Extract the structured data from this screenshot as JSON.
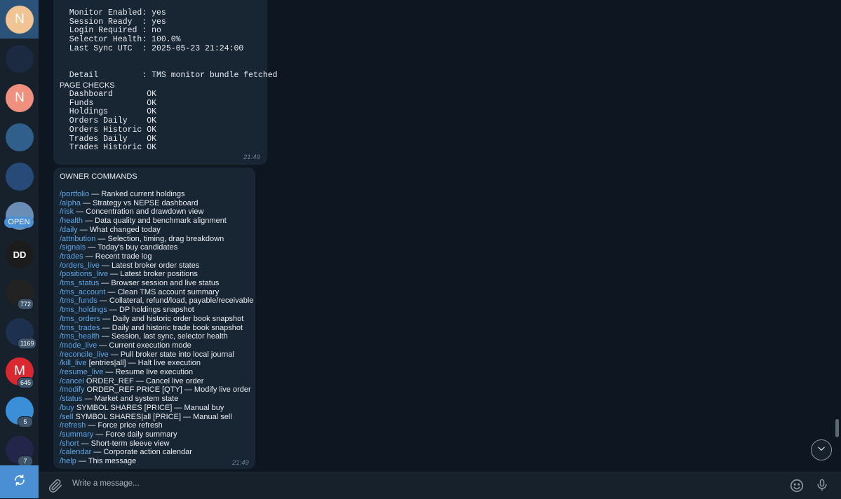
{
  "sidebar": {
    "chats": [
      {
        "initial": "N",
        "color": "#f0c493",
        "badge": ""
      },
      {
        "initial": "",
        "color": "#1b2a40",
        "badge": ""
      },
      {
        "initial": "N",
        "color": "#f0907e",
        "badge": ""
      },
      {
        "initial": "",
        "color": "#2f5f8a",
        "badge": ""
      },
      {
        "initial": "",
        "color": "#284a78",
        "badge": ""
      },
      {
        "initial": "",
        "color": "#6a8db5",
        "badge": "",
        "pill": "OPEN"
      },
      {
        "initial": "DD",
        "color": "#1c1c1c",
        "badge": ""
      },
      {
        "initial": "",
        "color": "#222222",
        "badge": "772"
      },
      {
        "initial": "",
        "color": "#1e3050",
        "badge": "1169"
      },
      {
        "initial": "M",
        "color": "#d9282f",
        "badge": "645"
      },
      {
        "initial": "",
        "color": "#3b8fd9",
        "badge": "5"
      },
      {
        "initial": "",
        "color": "#23264a",
        "badge": "7"
      }
    ],
    "refresh_icon": "refresh-icon"
  },
  "messages": {
    "status_block": {
      "lines": [
        "  Monitor Enabled: yes",
        "  Session Ready  : yes",
        "  Login Required : no",
        "  Selector Health: 100.0%",
        "  Last Sync UTC  : 2025-05-23 21:24:00",
        "",
        "",
        "  Detail         : TMS monitor bundle fetched"
      ],
      "page_checks_title": "PAGE CHECKS",
      "page_checks": [
        "  Dashboard       OK",
        "  Funds           OK",
        "  Holdings        OK",
        "  Orders Daily    OK",
        "  Orders Historic OK",
        "  Trades Daily    OK",
        "  Trades Historic OK"
      ],
      "time": "21:49"
    },
    "commands_block": {
      "title": "OWNER COMMANDS",
      "commands": [
        {
          "cmd": "/portfolio",
          "desc": " — Ranked current holdings"
        },
        {
          "cmd": "/alpha",
          "desc": " — Strategy vs NEPSE dashboard"
        },
        {
          "cmd": "/risk",
          "desc": " — Concentration and drawdown view"
        },
        {
          "cmd": "/health",
          "desc": " — Data quality and benchmark alignment"
        },
        {
          "cmd": "/daily",
          "desc": " — What changed today"
        },
        {
          "cmd": "/attribution",
          "desc": " — Selection, timing, drag breakdown"
        },
        {
          "cmd": "/signals",
          "desc": " — Today's buy candidates"
        },
        {
          "cmd": "/trades",
          "desc": " — Recent trade log"
        },
        {
          "cmd": "/orders_live",
          "desc": " — Latest broker order states"
        },
        {
          "cmd": "/positions_live",
          "desc": " — Latest broker positions"
        },
        {
          "cmd": "/tms_status",
          "desc": " — Browser session and live status"
        },
        {
          "cmd": "/tms_account",
          "desc": " — Clean TMS account summary"
        },
        {
          "cmd": "/tms_funds",
          "desc": " — Collateral, refund/load, payable/receivable"
        },
        {
          "cmd": "/tms_holdings",
          "desc": " — DP holdings snapshot"
        },
        {
          "cmd": "/tms_orders",
          "desc": " — Daily and historic order book snapshot"
        },
        {
          "cmd": "/tms_trades",
          "desc": " — Daily and historic trade book snapshot"
        },
        {
          "cmd": "/tms_health",
          "desc": " — Session, last sync, selector health"
        },
        {
          "cmd": "/mode_live",
          "desc": " — Current execution mode"
        },
        {
          "cmd": "/reconcile_live",
          "desc": " — Pull broker state into local journal"
        },
        {
          "cmd": "/kill_live",
          "desc": " [entries|all] — Halt live execution"
        },
        {
          "cmd": "/resume_live",
          "desc": " — Resume live execution"
        },
        {
          "cmd": "/cancel",
          "desc": " ORDER_REF — Cancel live order"
        },
        {
          "cmd": "/modify",
          "desc": " ORDER_REF PRICE [QTY] — Modify live order"
        },
        {
          "cmd": "/status",
          "desc": " — Market and system state"
        },
        {
          "cmd": "/buy",
          "desc": " SYMBOL SHARES [PRICE] — Manual buy"
        },
        {
          "cmd": "/sell",
          "desc": " SYMBOL SHARES|all [PRICE] — Manual sell"
        },
        {
          "cmd": "/refresh",
          "desc": " — Force price refresh"
        },
        {
          "cmd": "/summary",
          "desc": " — Force daily summary"
        },
        {
          "cmd": "/short",
          "desc": " — Short-term sleeve view"
        },
        {
          "cmd": "/calendar",
          "desc": " — Corporate action calendar"
        },
        {
          "cmd": "/help",
          "desc": " — This message"
        }
      ],
      "time": "21:49"
    }
  },
  "composer": {
    "placeholder": "Write a message...",
    "attach_icon": "paperclip-icon",
    "emoji_icon": "emoji-icon",
    "mic_icon": "microphone-icon"
  }
}
